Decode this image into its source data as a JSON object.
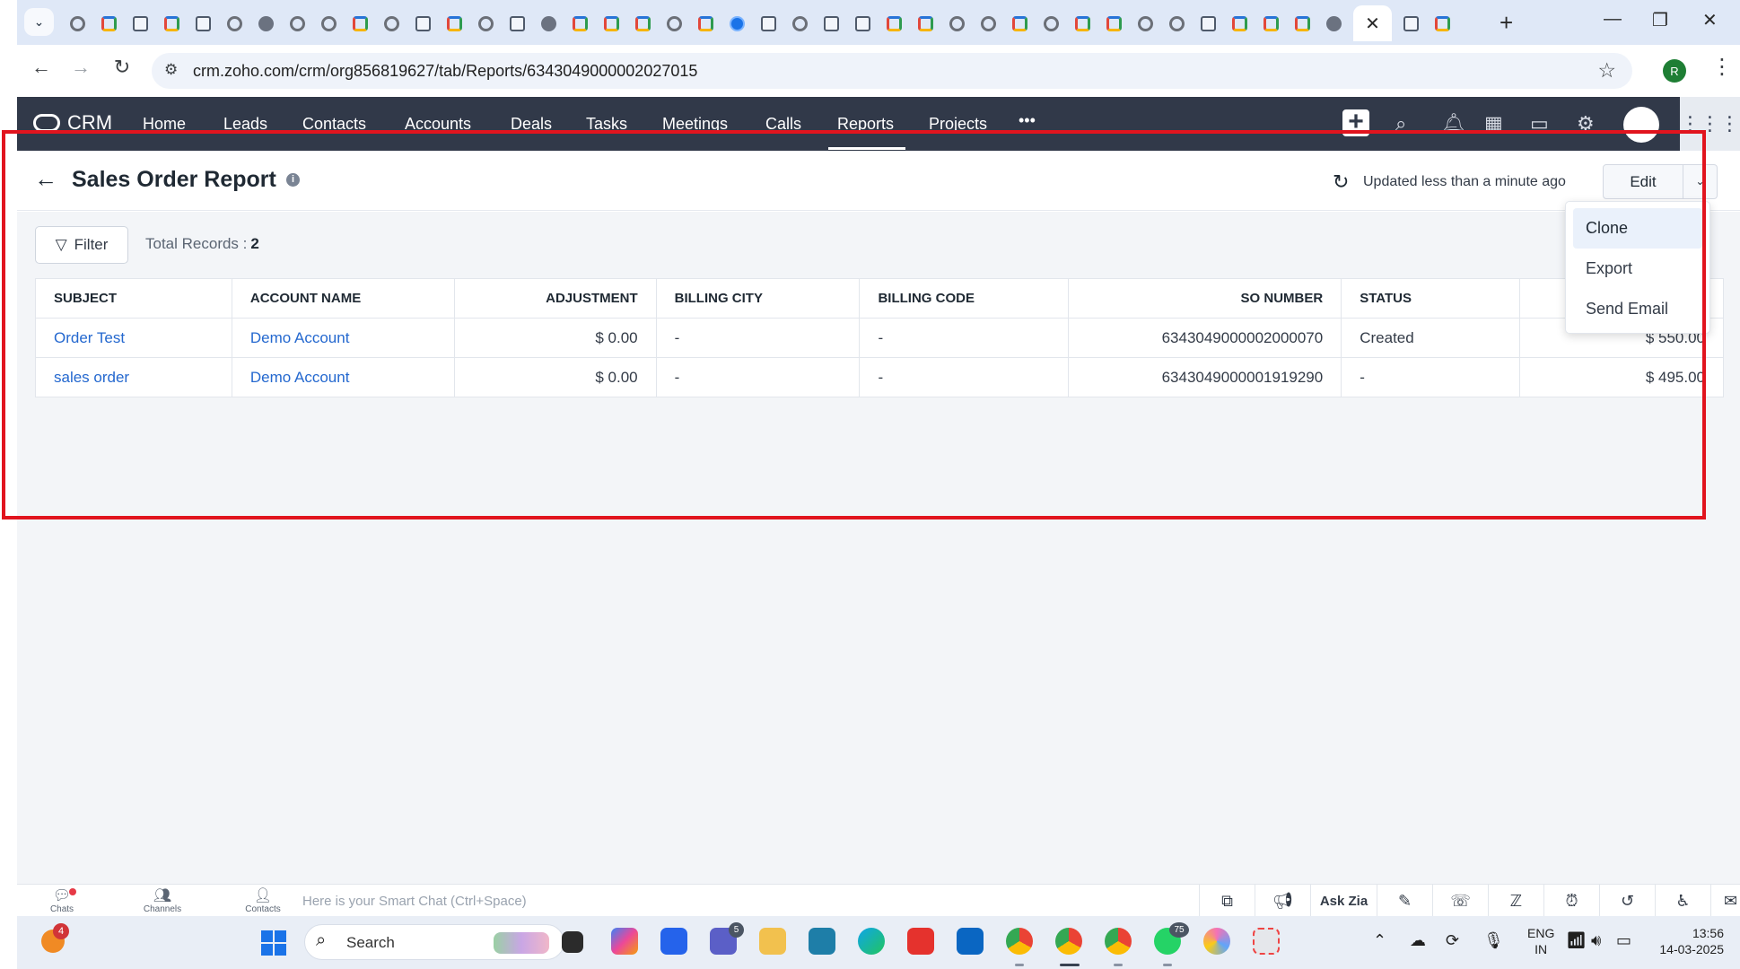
{
  "browser": {
    "tab_menu_icon": "chevron-down-icon",
    "active_tab_close": "✕",
    "new_tab": "+",
    "window_controls": {
      "minimize": "—",
      "restore": "❐",
      "close": "✕"
    },
    "url": "crm.zoho.com/crm/org856819627/tab/Reports/6343049000002027015",
    "profile_initial": "R"
  },
  "crm_nav": {
    "logo": "CRM",
    "tabs": [
      "Home",
      "Leads",
      "Contacts",
      "Accounts",
      "Deals",
      "Tasks",
      "Meetings",
      "Calls",
      "Reports",
      "Projects"
    ],
    "more": "•••",
    "active_tab": "Reports"
  },
  "report": {
    "title": "Sales Order Report",
    "updated": "Updated less than a minute ago",
    "edit_label": "Edit",
    "filter_label": "Filter",
    "total_records_label": "Total Records :",
    "total_records": "2",
    "columns": [
      "SUBJECT",
      "ACCOUNT NAME",
      "ADJUSTMENT",
      "BILLING CITY",
      "BILLING CODE",
      "SO NUMBER",
      "STATUS",
      ""
    ],
    "rows": [
      {
        "subject": "Order Test",
        "account": "Demo Account",
        "adjustment": "$ 0.00",
        "billing_city": "-",
        "billing_code": "-",
        "so_number": "6343049000002000070",
        "status": "Created",
        "total": "$ 550.00"
      },
      {
        "subject": "sales order",
        "account": "Demo Account",
        "adjustment": "$ 0.00",
        "billing_city": "-",
        "billing_code": "-",
        "so_number": "6343049000001919290",
        "status": "-",
        "total": "$ 495.00"
      }
    ]
  },
  "edit_menu": {
    "items": [
      "Clone",
      "Export",
      "Send Email"
    ],
    "hovered": "Clone"
  },
  "zoho_bar": {
    "chats": "Chats",
    "channels": "Channels",
    "contacts": "Contacts",
    "smart_chat_placeholder": "Here is your Smart Chat (Ctrl+Space)",
    "ask_zia": "Ask Zia"
  },
  "taskbar": {
    "weather_badge": "4",
    "search_label": "Search",
    "teams_badge": "5",
    "whatsapp_badge": "75",
    "lang_top": "ENG",
    "lang_bottom": "IN",
    "time": "13:56",
    "date": "14-03-2025"
  },
  "colors": {
    "crm_nav_bg": "#313949",
    "link": "#2468cf",
    "highlight": "#e1141e",
    "content_bg": "#f3f5f8"
  }
}
